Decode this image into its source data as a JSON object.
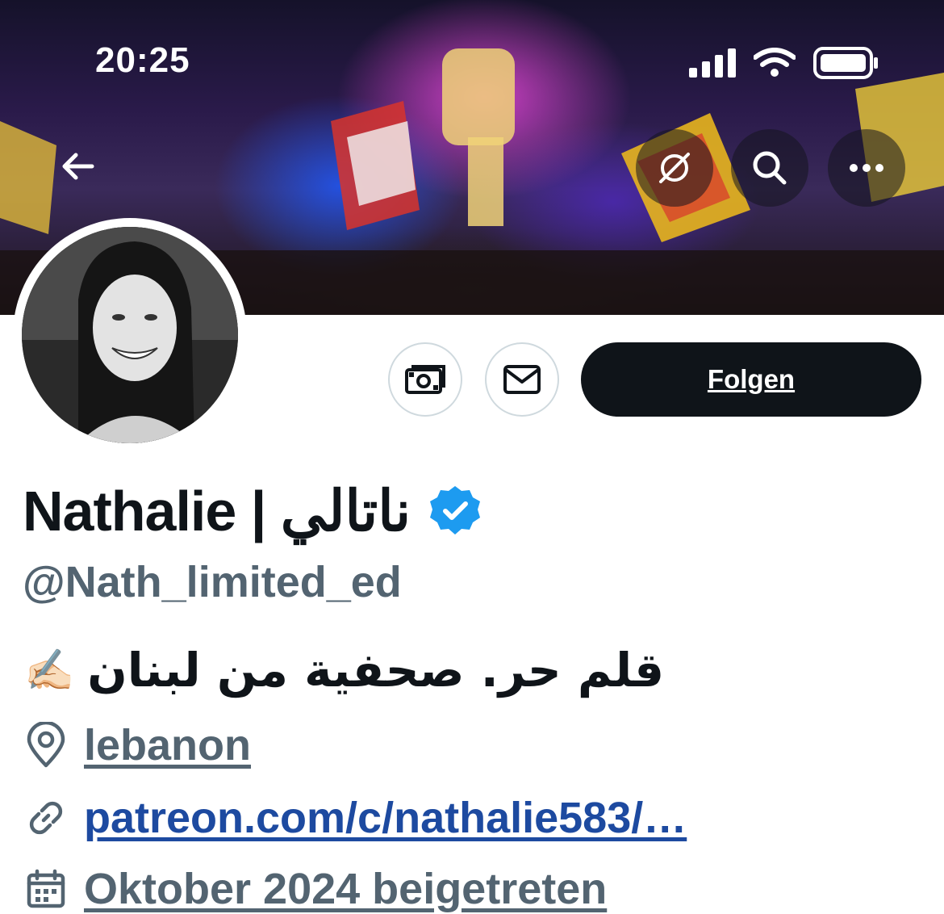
{
  "status_bar": {
    "time": "20:25"
  },
  "header": {
    "back_icon": "arrow-left-icon",
    "actions": [
      "grok-icon",
      "search-icon",
      "more-icon"
    ]
  },
  "profile": {
    "name": "Nathalie | ناتالي",
    "verified": true,
    "handle": "@Nath_limited_ed",
    "bio": "قلم حر. صحفية من لبنان",
    "bio_emoji": "✍🏻",
    "location": "lebanon",
    "website": "patreon.com/c/nathalie583/…",
    "joined": "Oktober 2024 beigetreten"
  },
  "actions": {
    "follow_label": "Folgen",
    "subscribe_icon": "money-icon",
    "message_icon": "mail-icon"
  },
  "colors": {
    "verified_badge": "#1d9bf0",
    "text_primary": "#0f1419",
    "text_secondary": "#536471",
    "link": "#1d4aa0",
    "follow_bg": "#0f1419"
  }
}
